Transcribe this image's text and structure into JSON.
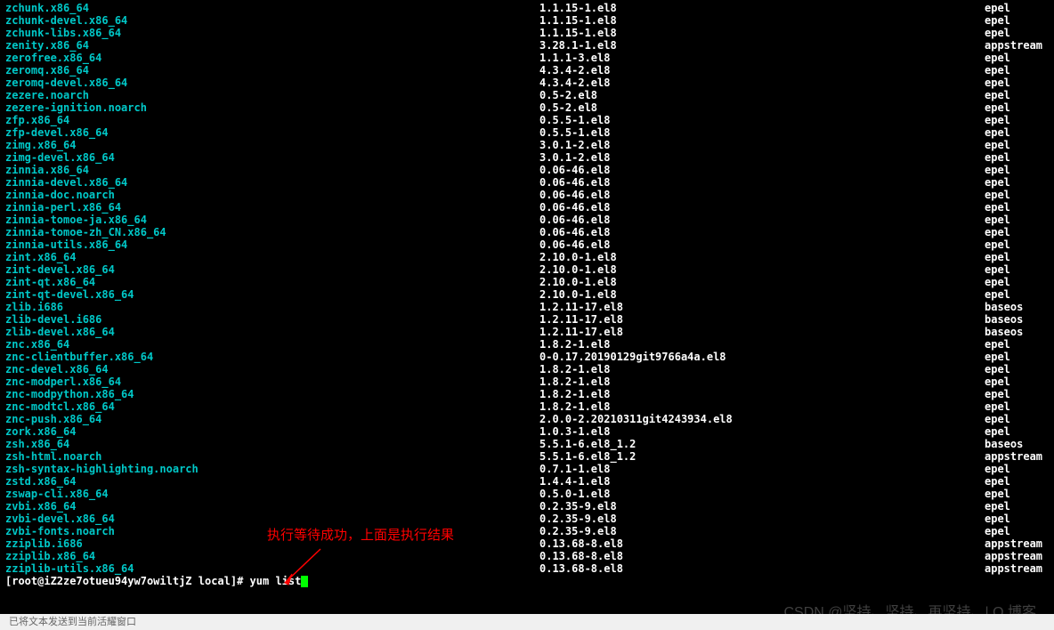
{
  "packages": [
    {
      "name": "zchunk.x86_64",
      "version": "1.1.15-1.el8",
      "repo": "epel"
    },
    {
      "name": "zchunk-devel.x86_64",
      "version": "1.1.15-1.el8",
      "repo": "epel"
    },
    {
      "name": "zchunk-libs.x86_64",
      "version": "1.1.15-1.el8",
      "repo": "epel"
    },
    {
      "name": "zenity.x86_64",
      "version": "3.28.1-1.el8",
      "repo": "appstream"
    },
    {
      "name": "zerofree.x86_64",
      "version": "1.1.1-3.el8",
      "repo": "epel"
    },
    {
      "name": "zeromq.x86_64",
      "version": "4.3.4-2.el8",
      "repo": "epel"
    },
    {
      "name": "zeromq-devel.x86_64",
      "version": "4.3.4-2.el8",
      "repo": "epel"
    },
    {
      "name": "zezere.noarch",
      "version": "0.5-2.el8",
      "repo": "epel"
    },
    {
      "name": "zezere-ignition.noarch",
      "version": "0.5-2.el8",
      "repo": "epel"
    },
    {
      "name": "zfp.x86_64",
      "version": "0.5.5-1.el8",
      "repo": "epel"
    },
    {
      "name": "zfp-devel.x86_64",
      "version": "0.5.5-1.el8",
      "repo": "epel"
    },
    {
      "name": "zimg.x86_64",
      "version": "3.0.1-2.el8",
      "repo": "epel"
    },
    {
      "name": "zimg-devel.x86_64",
      "version": "3.0.1-2.el8",
      "repo": "epel"
    },
    {
      "name": "zinnia.x86_64",
      "version": "0.06-46.el8",
      "repo": "epel"
    },
    {
      "name": "zinnia-devel.x86_64",
      "version": "0.06-46.el8",
      "repo": "epel"
    },
    {
      "name": "zinnia-doc.noarch",
      "version": "0.06-46.el8",
      "repo": "epel"
    },
    {
      "name": "zinnia-perl.x86_64",
      "version": "0.06-46.el8",
      "repo": "epel"
    },
    {
      "name": "zinnia-tomoe-ja.x86_64",
      "version": "0.06-46.el8",
      "repo": "epel"
    },
    {
      "name": "zinnia-tomoe-zh_CN.x86_64",
      "version": "0.06-46.el8",
      "repo": "epel"
    },
    {
      "name": "zinnia-utils.x86_64",
      "version": "0.06-46.el8",
      "repo": "epel"
    },
    {
      "name": "zint.x86_64",
      "version": "2.10.0-1.el8",
      "repo": "epel"
    },
    {
      "name": "zint-devel.x86_64",
      "version": "2.10.0-1.el8",
      "repo": "epel"
    },
    {
      "name": "zint-qt.x86_64",
      "version": "2.10.0-1.el8",
      "repo": "epel"
    },
    {
      "name": "zint-qt-devel.x86_64",
      "version": "2.10.0-1.el8",
      "repo": "epel"
    },
    {
      "name": "zlib.i686",
      "version": "1.2.11-17.el8",
      "repo": "baseos"
    },
    {
      "name": "zlib-devel.i686",
      "version": "1.2.11-17.el8",
      "repo": "baseos"
    },
    {
      "name": "zlib-devel.x86_64",
      "version": "1.2.11-17.el8",
      "repo": "baseos"
    },
    {
      "name": "znc.x86_64",
      "version": "1.8.2-1.el8",
      "repo": "epel"
    },
    {
      "name": "znc-clientbuffer.x86_64",
      "version": "0-0.17.20190129git9766a4a.el8",
      "repo": "epel"
    },
    {
      "name": "znc-devel.x86_64",
      "version": "1.8.2-1.el8",
      "repo": "epel"
    },
    {
      "name": "znc-modperl.x86_64",
      "version": "1.8.2-1.el8",
      "repo": "epel"
    },
    {
      "name": "znc-modpython.x86_64",
      "version": "1.8.2-1.el8",
      "repo": "epel"
    },
    {
      "name": "znc-modtcl.x86_64",
      "version": "1.8.2-1.el8",
      "repo": "epel"
    },
    {
      "name": "znc-push.x86_64",
      "version": "2.0.0-2.20210311git4243934.el8",
      "repo": "epel"
    },
    {
      "name": "zork.x86_64",
      "version": "1.0.3-1.el8",
      "repo": "epel"
    },
    {
      "name": "zsh.x86_64",
      "version": "5.5.1-6.el8_1.2",
      "repo": "baseos"
    },
    {
      "name": "zsh-html.noarch",
      "version": "5.5.1-6.el8_1.2",
      "repo": "appstream"
    },
    {
      "name": "zsh-syntax-highlighting.noarch",
      "version": "0.7.1-1.el8",
      "repo": "epel"
    },
    {
      "name": "zstd.x86_64",
      "version": "1.4.4-1.el8",
      "repo": "epel"
    },
    {
      "name": "zswap-cli.x86_64",
      "version": "0.5.0-1.el8",
      "repo": "epel"
    },
    {
      "name": "zvbi.x86_64",
      "version": "0.2.35-9.el8",
      "repo": "epel"
    },
    {
      "name": "zvbi-devel.x86_64",
      "version": "0.2.35-9.el8",
      "repo": "epel"
    },
    {
      "name": "zvbi-fonts.noarch",
      "version": "0.2.35-9.el8",
      "repo": "epel"
    },
    {
      "name": "zziplib.i686",
      "version": "0.13.68-8.el8",
      "repo": "appstream"
    },
    {
      "name": "zziplib.x86_64",
      "version": "0.13.68-8.el8",
      "repo": "appstream"
    },
    {
      "name": "zziplib-utils.x86_64",
      "version": "0.13.68-8.el8",
      "repo": "appstream"
    }
  ],
  "prompt": {
    "text": "[root@iZ2ze7otueu94yw7owiltjZ local]# ",
    "command": "yum list"
  },
  "annotation_text": "执行等待成功，上面是执行结果",
  "watermark": "CSDN @坚持、坚持、再坚持、| Q 博客",
  "status_bar_text": "已将文本发送到当前活耀窗口"
}
